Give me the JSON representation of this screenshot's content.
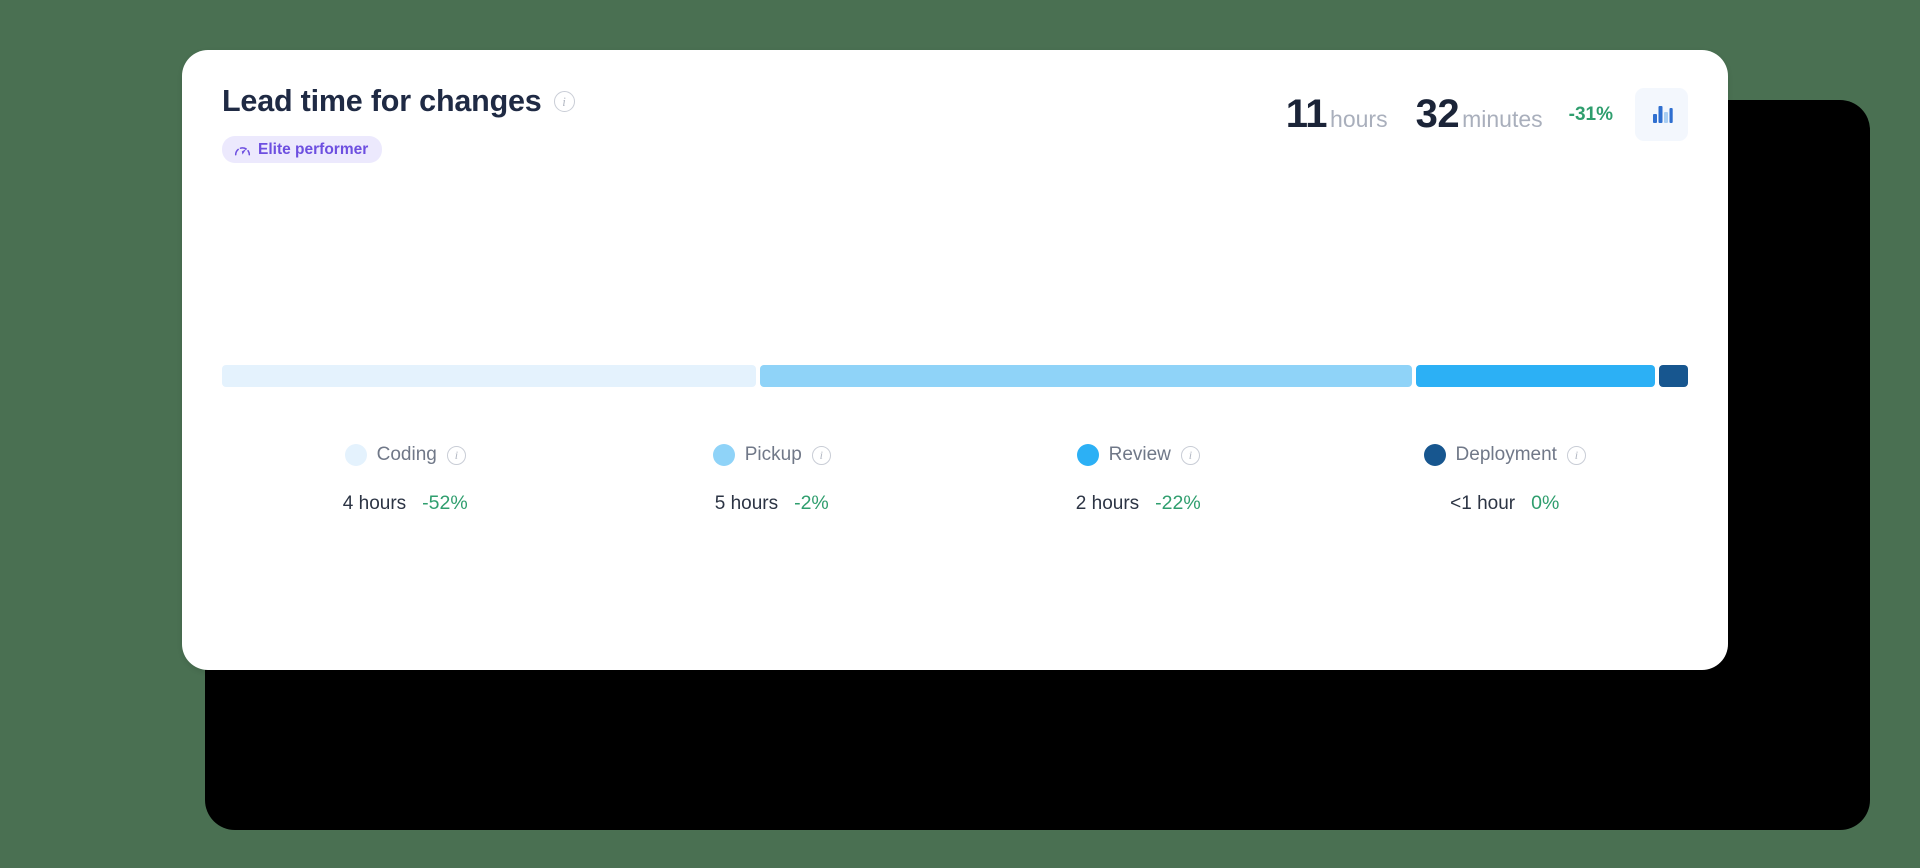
{
  "page": {
    "background_color": "#4a7052"
  },
  "card": {
    "title": "Lead time for changes",
    "title_info_icon": "info-icon",
    "badge": {
      "label": "Elite performer",
      "icon": "gauge-icon",
      "text_color": "#6d4fe0",
      "background_color": "#ece9fd"
    },
    "summary": {
      "hours_value": "11",
      "hours_unit": "hours",
      "minutes_value": "32",
      "minutes_unit": "minutes",
      "delta": "-31%",
      "delta_color": "#2f9e6e",
      "chart_button_icon": "bar-chart-icon"
    }
  },
  "chart_data": {
    "type": "bar",
    "title": "Lead time for changes",
    "orientation": "horizontal-stacked",
    "total_label": "11 hours 32 minutes",
    "total_delta": "-31%",
    "categories": [
      "Coding",
      "Pickup",
      "Review",
      "Deployment"
    ],
    "values": [
      4,
      5,
      2,
      0.5
    ],
    "value_labels": [
      "4 hours",
      "5 hours",
      "2 hours",
      "<1 hour"
    ],
    "deltas": [
      "-52%",
      "-2%",
      "-22%",
      "0%"
    ],
    "segment_percents": [
      36.7,
      44.9,
      16.4,
      2.0
    ],
    "colors": [
      "#e4f2fd",
      "#8fd3f8",
      "#2cb0f5",
      "#17568f"
    ],
    "xlabel": "",
    "ylabel": "",
    "grid": false,
    "legend": "bottom"
  },
  "legend": {
    "items": [
      {
        "label": "Coding",
        "color": "#e4f2fd",
        "value": "4 hours",
        "delta": "-52%",
        "info_icon": "info-icon"
      },
      {
        "label": "Pickup",
        "color": "#8fd3f8",
        "value": "5 hours",
        "delta": "-2%",
        "info_icon": "info-icon"
      },
      {
        "label": "Review",
        "color": "#2cb0f5",
        "value": "2 hours",
        "delta": "-22%",
        "info_icon": "info-icon"
      },
      {
        "label": "Deployment",
        "color": "#17568f",
        "value": "<1 hour",
        "delta": "0%",
        "info_icon": "info-icon"
      }
    ]
  }
}
